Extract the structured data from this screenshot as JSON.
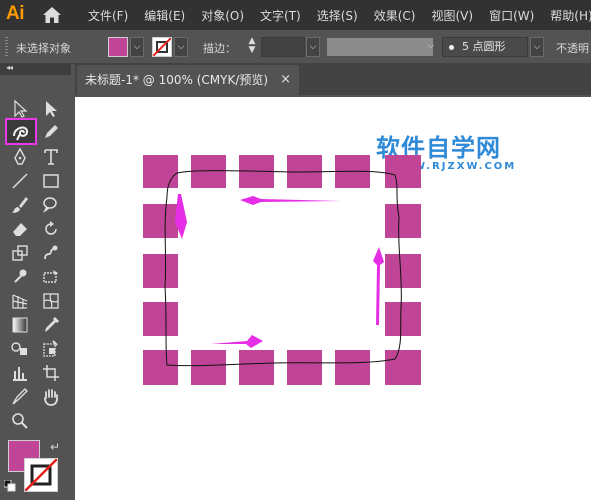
{
  "app": {
    "logo": "Ai"
  },
  "menu": [
    "文件(F)",
    "编辑(E)",
    "对象(O)",
    "文字(T)",
    "选择(S)",
    "效果(C)",
    "视图(V)",
    "窗口(W)",
    "帮助(H)"
  ],
  "control": {
    "selection_label": "未选择对象",
    "stroke_label": "描边：",
    "brush_label": "5 点圆形",
    "opacity_label": "不透明"
  },
  "document": {
    "tab_title": "未标题-1* @ 100% (CMYK/预览)",
    "close_glyph": "×"
  },
  "watermark": {
    "title": "软件自学网",
    "url": "WWW.RJZXW.COM"
  },
  "colors": {
    "fill": "#c04597",
    "arrow": "#e52ee5",
    "highlight": "#e83ae8",
    "watermark": "#2f8ad8"
  },
  "tools": [
    "selection-tool",
    "direct-selection-tool",
    "shaper-tool",
    "pencil-tool",
    "pen-tool",
    "type-tool",
    "line-tool",
    "rectangle-tool",
    "paintbrush-tool",
    "blob-brush-tool",
    "eraser-tool",
    "rotate-tool",
    "scale-tool",
    "warp-tool",
    "puppet-warp-tool",
    "free-transform-tool",
    "perspective-grid-tool",
    "mesh-tool",
    "gradient-tool",
    "eyedropper-tool",
    "blend-tool",
    "live-paint-tool",
    "graph-tool",
    "artboard-tool",
    "slice-tool",
    "hand-tool",
    "zoom-tool"
  ]
}
